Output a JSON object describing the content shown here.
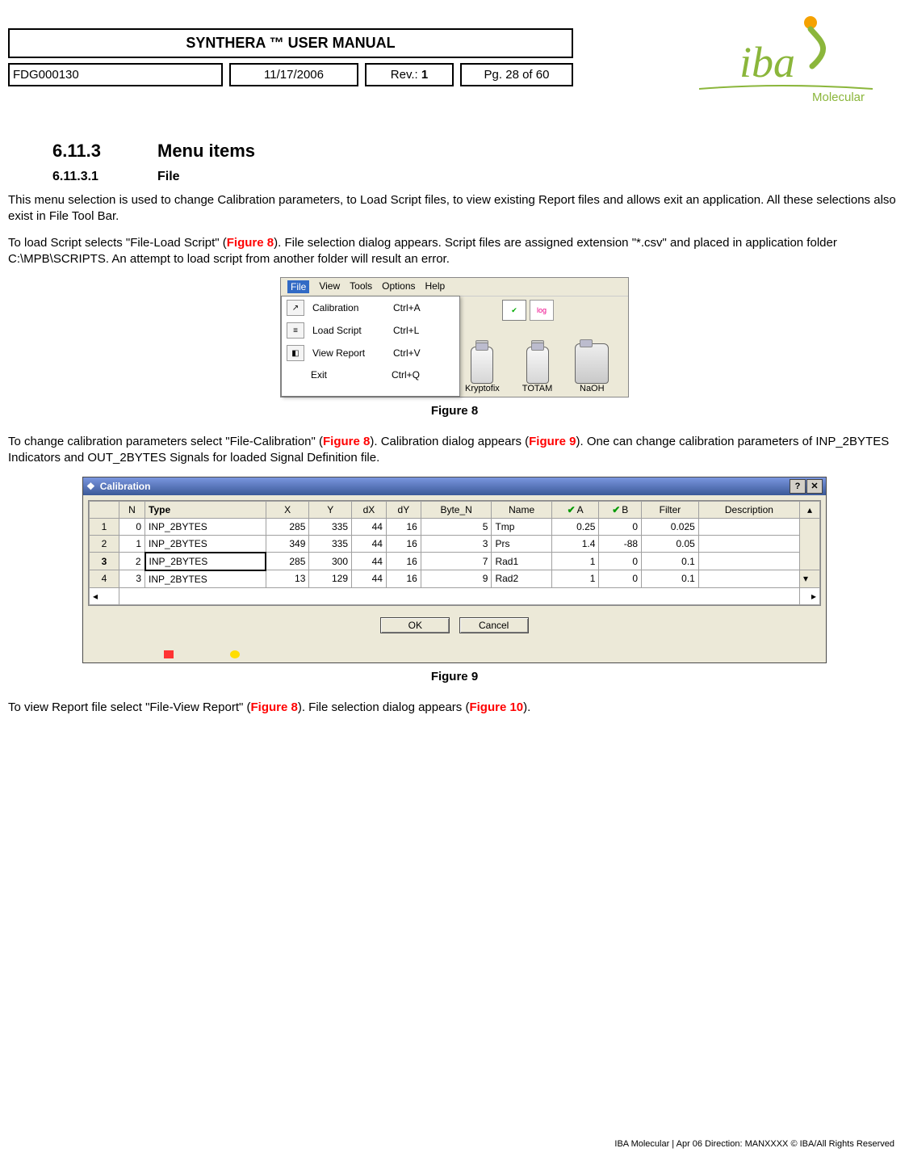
{
  "header": {
    "title": "SYNTHERA ™ USER MANUAL",
    "doc_id": "FDG000130",
    "date": "11/17/2006",
    "rev_label": "Rev.: ",
    "rev_value": "1",
    "page": "Pg. 28 of 60",
    "logo_name": "iba",
    "logo_sub": "Molecular"
  },
  "section": {
    "num": "6.11.3",
    "title": "Menu items"
  },
  "subsection": {
    "num": "6.11.3.1",
    "title": "File"
  },
  "para1": "This menu selection is used to change Calibration parameters, to Load Script files, to view existing Report files and allows exit an application. All these selections also exist in File Tool Bar.",
  "para2a": "To load Script selects \"File-Load Script\" (",
  "para2b": "). File selection dialog appears. Script files are assigned extension \"*.csv\" and placed in application folder C:\\MPB\\SCRIPTS. An attempt to load script from another folder will result an error.",
  "fig8": {
    "menus": [
      "File",
      "View",
      "Tools",
      "Options",
      "Help"
    ],
    "items": [
      {
        "icon": "cal",
        "label": "Calibration",
        "shortcut": "Ctrl+A"
      },
      {
        "icon": "load",
        "label": "Load Script",
        "shortcut": "Ctrl+L"
      },
      {
        "icon": "view",
        "label": "View Report",
        "shortcut": "Ctrl+V"
      },
      {
        "icon": "",
        "label": "Exit",
        "shortcut": "Ctrl+Q"
      }
    ],
    "log_icon": "log",
    "vials": [
      "Kryptofix",
      "TOTAM",
      "NaOH"
    ],
    "caption": "Figure 8"
  },
  "para3a": "To change calibration parameters select \"File-Calibration\" (",
  "para3b": "). Calibration dialog appears (",
  "para3c": "). One can change calibration parameters of INP_2BYTES Indicators and OUT_2BYTES Signals for loaded Signal Definition file.",
  "fig9": {
    "title": "Calibration",
    "columns": [
      "",
      "N",
      "Type",
      "X",
      "Y",
      "dX",
      "dY",
      "Byte_N",
      "Name",
      "A",
      "B",
      "Filter",
      "Description"
    ],
    "rows": [
      {
        "r": "1",
        "N": "0",
        "Type": "INP_2BYTES",
        "X": "285",
        "Y": "335",
        "dX": "44",
        "dY": "16",
        "Byte_N": "5",
        "Name": "Tmp",
        "A": "0.25",
        "B": "0",
        "Filter": "0.025",
        "Description": ""
      },
      {
        "r": "2",
        "N": "1",
        "Type": "INP_2BYTES",
        "X": "349",
        "Y": "335",
        "dX": "44",
        "dY": "16",
        "Byte_N": "3",
        "Name": "Prs",
        "A": "1.4",
        "B": "-88",
        "Filter": "0.05",
        "Description": ""
      },
      {
        "r": "3",
        "N": "2",
        "Type": "INP_2BYTES",
        "X": "285",
        "Y": "300",
        "dX": "44",
        "dY": "16",
        "Byte_N": "7",
        "Name": "Rad1",
        "A": "1",
        "B": "0",
        "Filter": "0.1",
        "Description": ""
      },
      {
        "r": "4",
        "N": "3",
        "Type": "INP_2BYTES",
        "X": "13",
        "Y": "129",
        "dX": "44",
        "dY": "16",
        "Byte_N": "9",
        "Name": "Rad2",
        "A": "1",
        "B": "0",
        "Filter": "0.1",
        "Description": ""
      }
    ],
    "ok": "OK",
    "cancel": "Cancel",
    "caption": "Figure 9"
  },
  "para4a": "To view Report file select \"File-View Report\" (",
  "para4b": "). File selection dialog appears (",
  "para4c": ").",
  "refs": {
    "fig8": "Figure 8",
    "fig9": "Figure 9",
    "fig10": "Figure 10"
  },
  "footer": "IBA Molecular  |  Apr 06 Direction: MANXXXX © IBA/All Rights Reserved"
}
